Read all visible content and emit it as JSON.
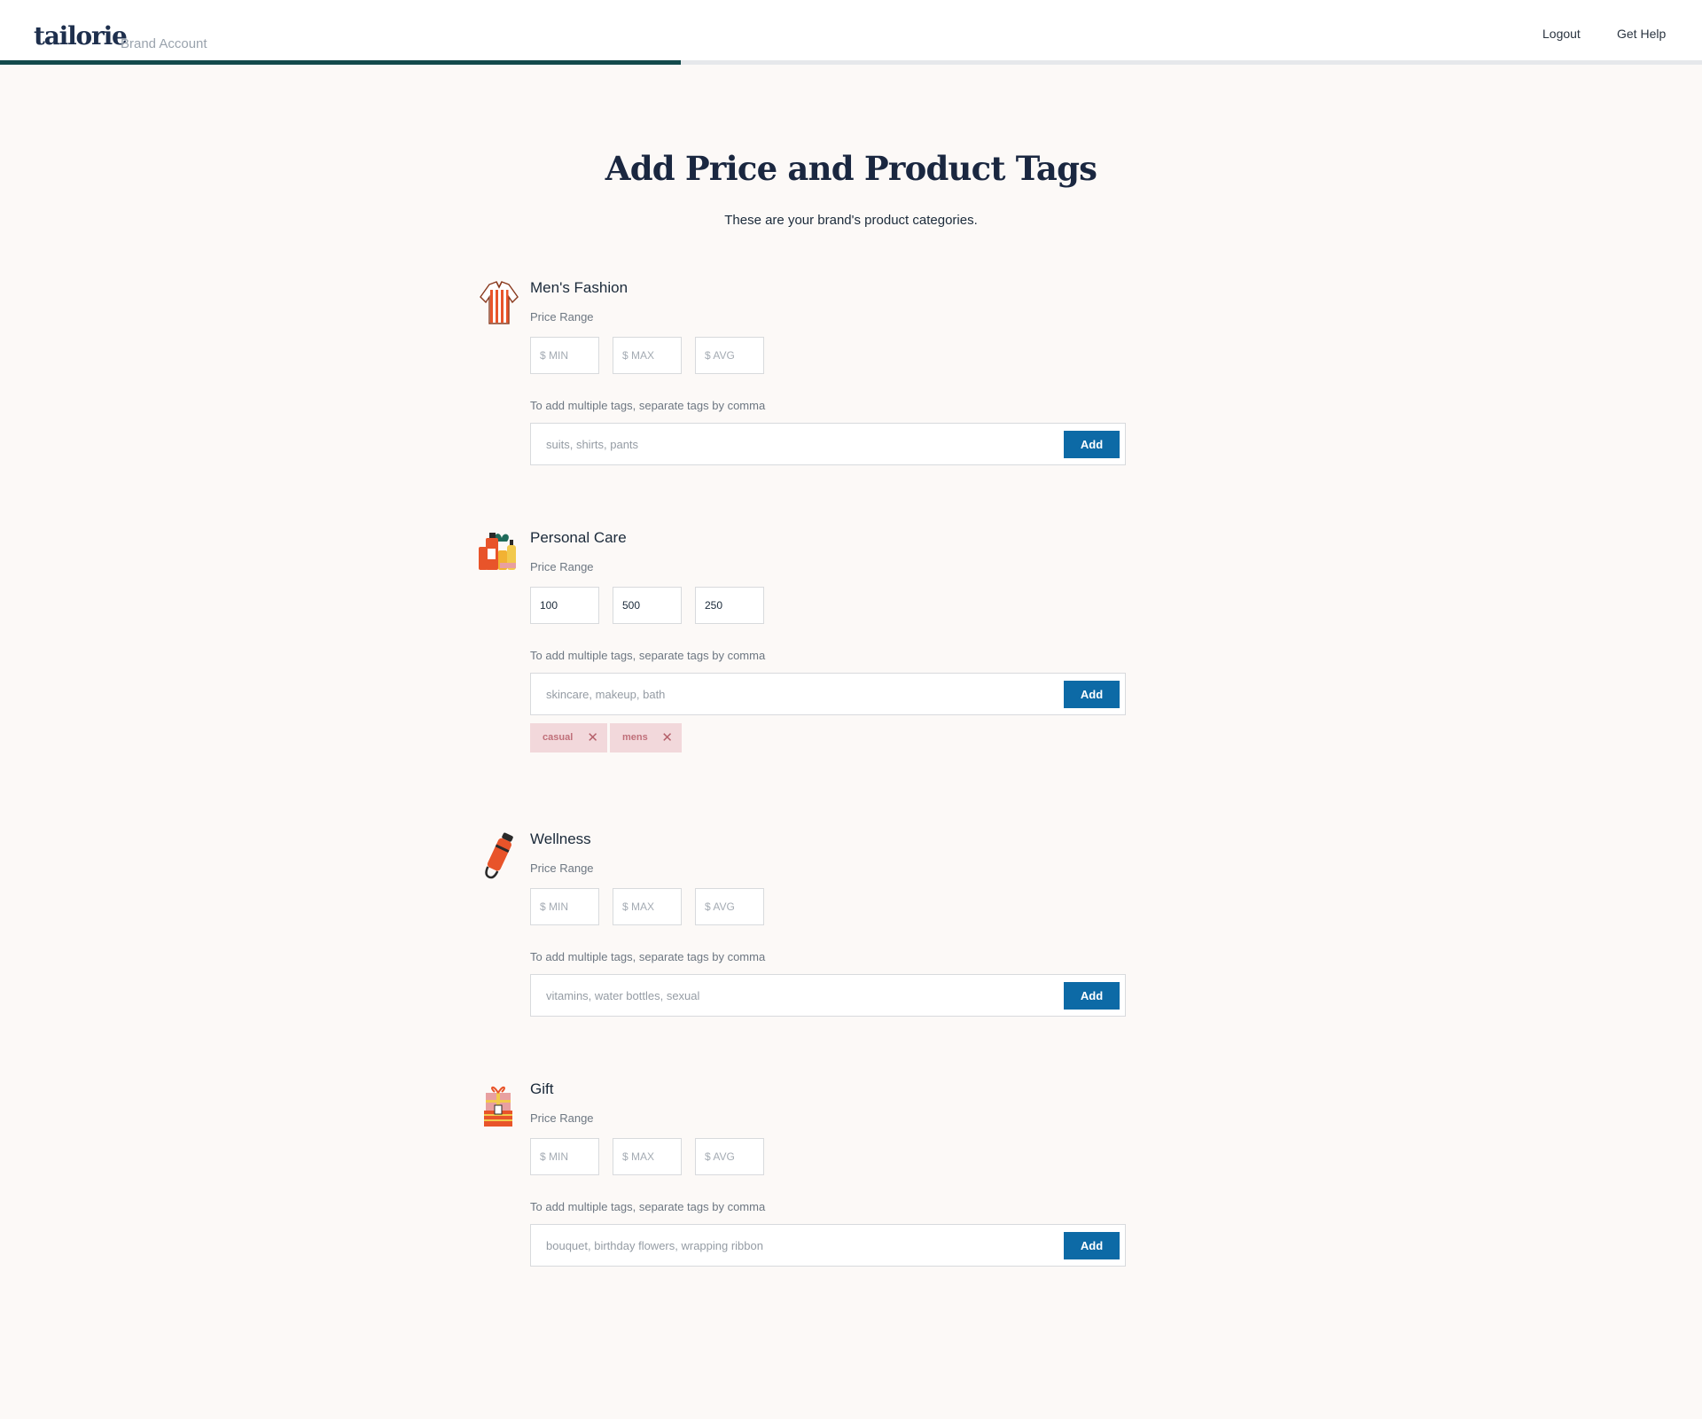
{
  "header": {
    "logo": "tailorie",
    "account_label": "Brand Account",
    "nav": {
      "logout": "Logout",
      "help": "Get Help"
    },
    "progress_percent": 40
  },
  "page": {
    "title": "Add Price and Product Tags",
    "subtitle": "These are your brand's product categories."
  },
  "labels": {
    "price_range": "Price Range",
    "tags_help": "To add multiple tags, separate tags by comma",
    "add_button": "Add",
    "min_placeholder": "$ MIN",
    "max_placeholder": "$ MAX",
    "avg_placeholder": "$ AVG"
  },
  "categories": [
    {
      "name": "Men's Fashion",
      "icon": "shirt-icon",
      "min": "",
      "max": "",
      "avg": "",
      "tag_placeholder": "suits, shirts, pants",
      "tags": []
    },
    {
      "name": "Personal Care",
      "icon": "personal-care-products-icon",
      "min": "100",
      "max": "500",
      "avg": "250",
      "tag_placeholder": "skincare, makeup, bath",
      "tags": [
        "casual",
        "mens"
      ]
    },
    {
      "name": "Wellness",
      "icon": "water-bottle-icon",
      "min": "",
      "max": "",
      "avg": "",
      "tag_placeholder": "vitamins, water bottles, sexual",
      "tags": []
    },
    {
      "name": "Gift",
      "icon": "gift-box-icon",
      "min": "",
      "max": "",
      "avg": "",
      "tag_placeholder": "bouquet, birthday flowers, wrapping ribbon",
      "tags": []
    }
  ],
  "colors": {
    "background": "#fcf9f7",
    "brand_navy": "#1e2f4d",
    "progress": "#134a4c",
    "add_button": "#0d6aa6",
    "chip_bg": "#f2d8db",
    "chip_text": "#c0707a",
    "icon_orange": "#e8542a"
  }
}
